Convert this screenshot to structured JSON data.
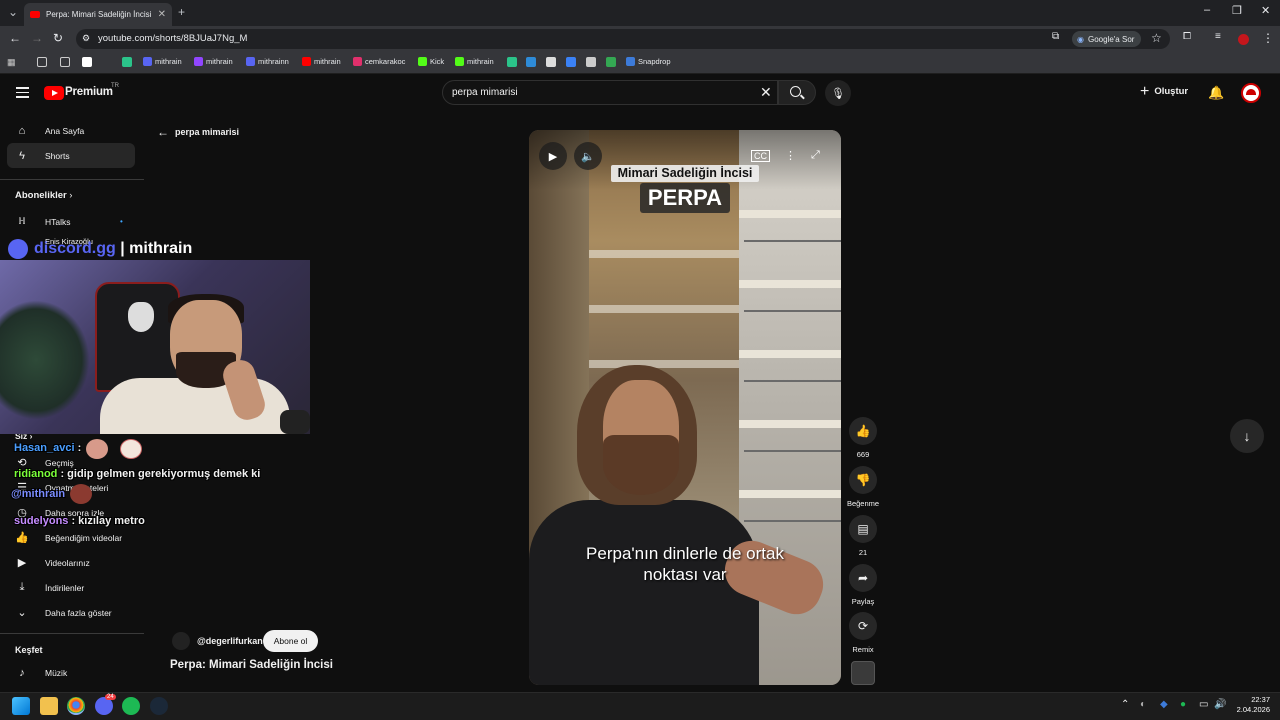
{
  "browser": {
    "tab_title": "Perpa: Mimari Sadeliğin İncisi -",
    "url": "youtube.com/shorts/8BJUaJ7Ng_M",
    "google_sor": "Google'a Sor",
    "bookmarks": [
      "mithrain",
      "mithrain",
      "mithrainn",
      "mithrain",
      "cemkarakoc",
      "Kick",
      "mithrain",
      "Snapdrop"
    ]
  },
  "header": {
    "brand": "Premium",
    "region": "TR",
    "search_value": "perpa mimarisi",
    "create_label": "Oluştur"
  },
  "sidebar": {
    "home": "Ana Sayfa",
    "shorts": "Shorts",
    "subscriptions": "Abonelikler",
    "sub_channels": [
      "HTalks",
      "Enis Kirazoğlu"
    ],
    "you": "Siz",
    "history": "Geçmiş",
    "playlists": "Oynatma listeleri",
    "watch_later": "Daha sonra izle",
    "liked": "Beğendiğim videolar",
    "your_videos": "Videolarınız",
    "downloads": "İndirilenler",
    "show_more": "Daha fazla göster",
    "explore": "Keşfet",
    "music": "Müzik"
  },
  "overlay": {
    "discord_prefix": "discord.gg",
    "discord_name": " | mithrain",
    "chat": [
      {
        "user": "Hasan_avci",
        "text": " :",
        "color": "#4a9eff"
      },
      {
        "user": "ridianod",
        "text": " : gidip gelmen gerekiyormuş demek ki",
        "color": "#7cff3a"
      },
      {
        "user": "@mithrain",
        "text": "",
        "color": "#7a8cff"
      },
      {
        "user": "sudelyons",
        "text": " : kızılay metro",
        "color": "#c58cff"
      }
    ]
  },
  "shorts": {
    "back_label": "perpa mimarisi",
    "channel": "@degerlifurkan",
    "subscribe": "Abone ol",
    "title": "Perpa: Mimari Sadeliğin İncisi",
    "caption_top": "Mimari Sadeliğin İncisi",
    "caption_big": "PERPA",
    "subtitle_line1": "Perpa'nın dinlerle de ortak",
    "subtitle_line2": "noktası var",
    "likes": "669",
    "dislike_label": "Beğenme",
    "comments": "21",
    "share_label": "Paylaş",
    "remix_label": "Remix"
  },
  "taskbar": {
    "time": "22:37",
    "date": "2.04.2026",
    "discord_badge": "24"
  },
  "colors": {
    "youtube_red": "#ff0000",
    "discord": "#5865f2",
    "background": "#0f0f0f"
  }
}
